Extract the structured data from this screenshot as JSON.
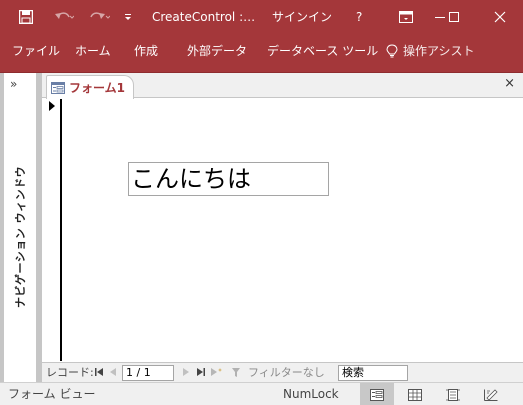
{
  "titlebar": {
    "title": "CreateControl :…",
    "signin": "サインイン",
    "help": "?"
  },
  "ribbon": {
    "tabs": [
      {
        "label": "ファイル"
      },
      {
        "label": "ホーム"
      },
      {
        "label": "作成"
      },
      {
        "label": "外部データ"
      },
      {
        "label": "データベース ツール"
      }
    ],
    "tell_me": "操作アシスト"
  },
  "nav_pane": {
    "toggle": "»",
    "label": "ナビゲーション ウィンドウ"
  },
  "document": {
    "tab_label": "フォーム1",
    "close": "×",
    "textbox_value": "こんにちは"
  },
  "record_nav": {
    "label": "レコード:",
    "position": "1 / 1",
    "filter": "フィルターなし",
    "search_placeholder": "検索"
  },
  "status": {
    "view_name": "フォーム ビュー",
    "numlock": "NumLock"
  },
  "colors": {
    "accent": "#a4373a"
  }
}
